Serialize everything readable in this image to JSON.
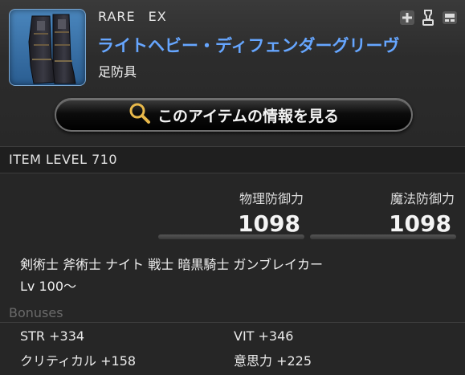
{
  "item": {
    "rarity": "RARE",
    "ex": "EX",
    "name": "ライトヘビー・ディフェンダーグリーヴ",
    "slot": "足防具",
    "icon": "boots-icon"
  },
  "header_icons": [
    "plus-icon",
    "glamour-icon",
    "dye-icon"
  ],
  "info_button": {
    "label": "このアイテムの情報を見る",
    "icon": "magnifier-icon"
  },
  "item_level": "ITEM LEVEL 710",
  "stats": {
    "physical": {
      "label": "物理防御力",
      "value": "1098"
    },
    "magical": {
      "label": "魔法防御力",
      "value": "1098"
    }
  },
  "jobs": "剣術士 斧術士 ナイト 戦士 暗黒騎士 ガンブレイカー",
  "level": "Lv 100～",
  "bonuses": {
    "title": "Bonuses",
    "items": [
      {
        "text": "STR +334"
      },
      {
        "text": "VIT +346"
      },
      {
        "text": "クリティカル +158"
      },
      {
        "text": "意思力 +225"
      }
    ]
  },
  "colors": {
    "item_name": "#66a6ff",
    "background": "#262626",
    "muted_title": "#6a6a6a"
  }
}
